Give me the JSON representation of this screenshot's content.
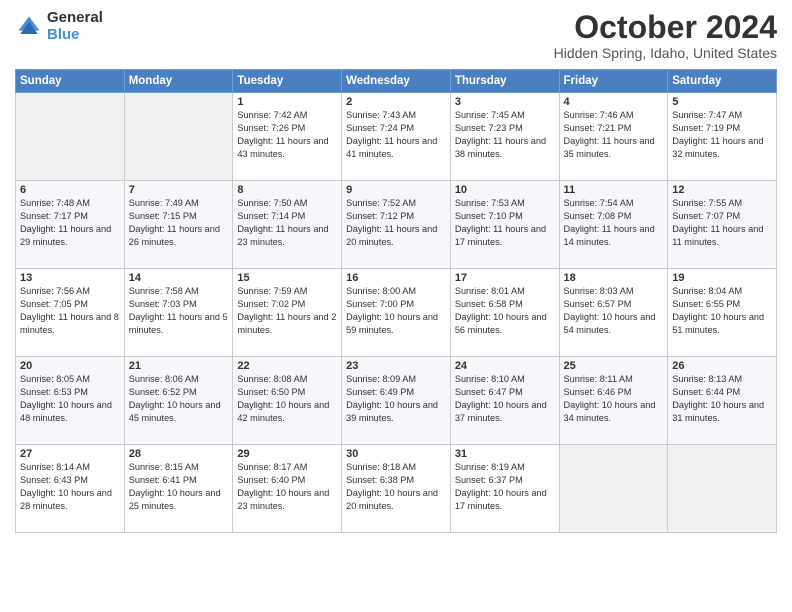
{
  "header": {
    "logo_general": "General",
    "logo_blue": "Blue",
    "title": "October 2024",
    "location": "Hidden Spring, Idaho, United States"
  },
  "days_of_week": [
    "Sunday",
    "Monday",
    "Tuesday",
    "Wednesday",
    "Thursday",
    "Friday",
    "Saturday"
  ],
  "weeks": [
    [
      {
        "day": "",
        "sunrise": "",
        "sunset": "",
        "daylight": ""
      },
      {
        "day": "",
        "sunrise": "",
        "sunset": "",
        "daylight": ""
      },
      {
        "day": "1",
        "sunrise": "Sunrise: 7:42 AM",
        "sunset": "Sunset: 7:26 PM",
        "daylight": "Daylight: 11 hours and 43 minutes."
      },
      {
        "day": "2",
        "sunrise": "Sunrise: 7:43 AM",
        "sunset": "Sunset: 7:24 PM",
        "daylight": "Daylight: 11 hours and 41 minutes."
      },
      {
        "day": "3",
        "sunrise": "Sunrise: 7:45 AM",
        "sunset": "Sunset: 7:23 PM",
        "daylight": "Daylight: 11 hours and 38 minutes."
      },
      {
        "day": "4",
        "sunrise": "Sunrise: 7:46 AM",
        "sunset": "Sunset: 7:21 PM",
        "daylight": "Daylight: 11 hours and 35 minutes."
      },
      {
        "day": "5",
        "sunrise": "Sunrise: 7:47 AM",
        "sunset": "Sunset: 7:19 PM",
        "daylight": "Daylight: 11 hours and 32 minutes."
      }
    ],
    [
      {
        "day": "6",
        "sunrise": "Sunrise: 7:48 AM",
        "sunset": "Sunset: 7:17 PM",
        "daylight": "Daylight: 11 hours and 29 minutes."
      },
      {
        "day": "7",
        "sunrise": "Sunrise: 7:49 AM",
        "sunset": "Sunset: 7:15 PM",
        "daylight": "Daylight: 11 hours and 26 minutes."
      },
      {
        "day": "8",
        "sunrise": "Sunrise: 7:50 AM",
        "sunset": "Sunset: 7:14 PM",
        "daylight": "Daylight: 11 hours and 23 minutes."
      },
      {
        "day": "9",
        "sunrise": "Sunrise: 7:52 AM",
        "sunset": "Sunset: 7:12 PM",
        "daylight": "Daylight: 11 hours and 20 minutes."
      },
      {
        "day": "10",
        "sunrise": "Sunrise: 7:53 AM",
        "sunset": "Sunset: 7:10 PM",
        "daylight": "Daylight: 11 hours and 17 minutes."
      },
      {
        "day": "11",
        "sunrise": "Sunrise: 7:54 AM",
        "sunset": "Sunset: 7:08 PM",
        "daylight": "Daylight: 11 hours and 14 minutes."
      },
      {
        "day": "12",
        "sunrise": "Sunrise: 7:55 AM",
        "sunset": "Sunset: 7:07 PM",
        "daylight": "Daylight: 11 hours and 11 minutes."
      }
    ],
    [
      {
        "day": "13",
        "sunrise": "Sunrise: 7:56 AM",
        "sunset": "Sunset: 7:05 PM",
        "daylight": "Daylight: 11 hours and 8 minutes."
      },
      {
        "day": "14",
        "sunrise": "Sunrise: 7:58 AM",
        "sunset": "Sunset: 7:03 PM",
        "daylight": "Daylight: 11 hours and 5 minutes."
      },
      {
        "day": "15",
        "sunrise": "Sunrise: 7:59 AM",
        "sunset": "Sunset: 7:02 PM",
        "daylight": "Daylight: 11 hours and 2 minutes."
      },
      {
        "day": "16",
        "sunrise": "Sunrise: 8:00 AM",
        "sunset": "Sunset: 7:00 PM",
        "daylight": "Daylight: 10 hours and 59 minutes."
      },
      {
        "day": "17",
        "sunrise": "Sunrise: 8:01 AM",
        "sunset": "Sunset: 6:58 PM",
        "daylight": "Daylight: 10 hours and 56 minutes."
      },
      {
        "day": "18",
        "sunrise": "Sunrise: 8:03 AM",
        "sunset": "Sunset: 6:57 PM",
        "daylight": "Daylight: 10 hours and 54 minutes."
      },
      {
        "day": "19",
        "sunrise": "Sunrise: 8:04 AM",
        "sunset": "Sunset: 6:55 PM",
        "daylight": "Daylight: 10 hours and 51 minutes."
      }
    ],
    [
      {
        "day": "20",
        "sunrise": "Sunrise: 8:05 AM",
        "sunset": "Sunset: 6:53 PM",
        "daylight": "Daylight: 10 hours and 48 minutes."
      },
      {
        "day": "21",
        "sunrise": "Sunrise: 8:06 AM",
        "sunset": "Sunset: 6:52 PM",
        "daylight": "Daylight: 10 hours and 45 minutes."
      },
      {
        "day": "22",
        "sunrise": "Sunrise: 8:08 AM",
        "sunset": "Sunset: 6:50 PM",
        "daylight": "Daylight: 10 hours and 42 minutes."
      },
      {
        "day": "23",
        "sunrise": "Sunrise: 8:09 AM",
        "sunset": "Sunset: 6:49 PM",
        "daylight": "Daylight: 10 hours and 39 minutes."
      },
      {
        "day": "24",
        "sunrise": "Sunrise: 8:10 AM",
        "sunset": "Sunset: 6:47 PM",
        "daylight": "Daylight: 10 hours and 37 minutes."
      },
      {
        "day": "25",
        "sunrise": "Sunrise: 8:11 AM",
        "sunset": "Sunset: 6:46 PM",
        "daylight": "Daylight: 10 hours and 34 minutes."
      },
      {
        "day": "26",
        "sunrise": "Sunrise: 8:13 AM",
        "sunset": "Sunset: 6:44 PM",
        "daylight": "Daylight: 10 hours and 31 minutes."
      }
    ],
    [
      {
        "day": "27",
        "sunrise": "Sunrise: 8:14 AM",
        "sunset": "Sunset: 6:43 PM",
        "daylight": "Daylight: 10 hours and 28 minutes."
      },
      {
        "day": "28",
        "sunrise": "Sunrise: 8:15 AM",
        "sunset": "Sunset: 6:41 PM",
        "daylight": "Daylight: 10 hours and 25 minutes."
      },
      {
        "day": "29",
        "sunrise": "Sunrise: 8:17 AM",
        "sunset": "Sunset: 6:40 PM",
        "daylight": "Daylight: 10 hours and 23 minutes."
      },
      {
        "day": "30",
        "sunrise": "Sunrise: 8:18 AM",
        "sunset": "Sunset: 6:38 PM",
        "daylight": "Daylight: 10 hours and 20 minutes."
      },
      {
        "day": "31",
        "sunrise": "Sunrise: 8:19 AM",
        "sunset": "Sunset: 6:37 PM",
        "daylight": "Daylight: 10 hours and 17 minutes."
      },
      {
        "day": "",
        "sunrise": "",
        "sunset": "",
        "daylight": ""
      },
      {
        "day": "",
        "sunrise": "",
        "sunset": "",
        "daylight": ""
      }
    ]
  ]
}
